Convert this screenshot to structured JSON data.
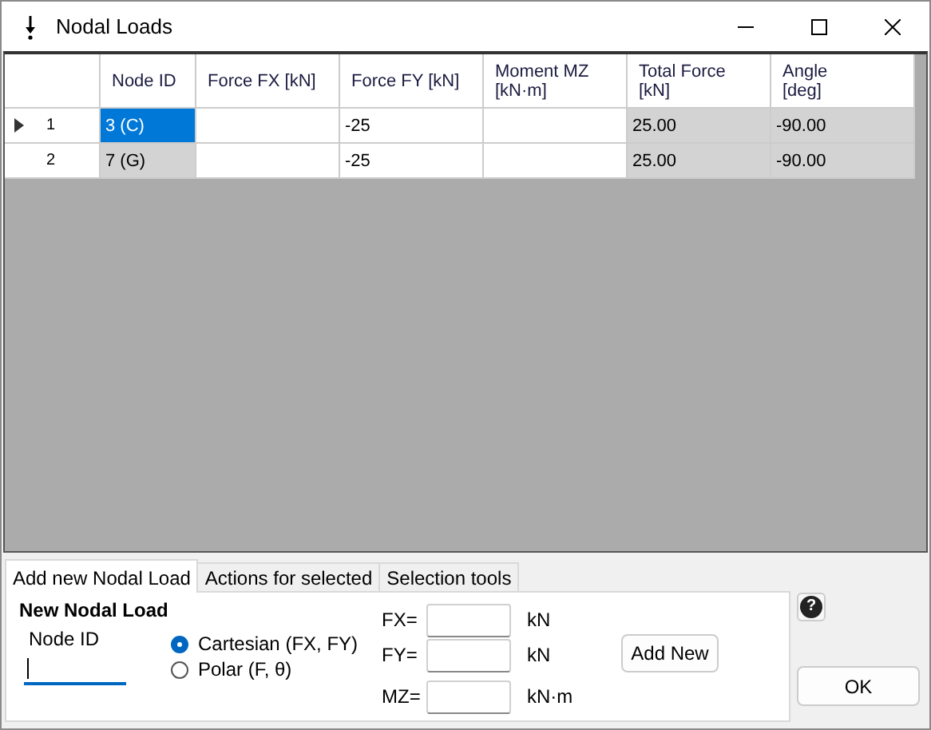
{
  "window": {
    "title": "Nodal Loads"
  },
  "table": {
    "columns": [
      "Node ID",
      "Force FX [kN]",
      "Force FY [kN]",
      "Moment MZ\n[kN·m]",
      "Total Force\n[kN]",
      "Angle\n[deg]"
    ],
    "rows": [
      {
        "number": "1",
        "current": true,
        "cells": [
          {
            "text": "3 (C)",
            "readonly": true,
            "selected": true
          },
          {
            "readonly": false,
            "selected": false
          },
          {
            "text": "-25",
            "readonly": false,
            "selected": false
          },
          {
            "readonly": false,
            "selected": false
          },
          {
            "text": "25.00",
            "readonly": true,
            "selected": false
          },
          {
            "text": "-90.00",
            "readonly": true,
            "selected": false
          }
        ]
      },
      {
        "number": "2",
        "current": false,
        "cells": [
          {
            "text": "7 (G)",
            "readonly": true,
            "selected": false
          },
          {
            "readonly": false,
            "selected": false
          },
          {
            "text": "-25",
            "readonly": false,
            "selected": false
          },
          {
            "readonly": false,
            "selected": false
          },
          {
            "text": "25.00",
            "readonly": true,
            "selected": false
          },
          {
            "text": "-90.00",
            "readonly": true,
            "selected": false
          }
        ]
      }
    ]
  },
  "tabs": [
    {
      "label": "Add new Nodal Load",
      "selected": true
    },
    {
      "label": "Actions for selected",
      "selected": false
    },
    {
      "label": "Selection tools",
      "selected": false
    }
  ],
  "form": {
    "title": "New Nodal Load",
    "node_id_label": "Node ID",
    "node_id_focused": true,
    "modes": [
      {
        "label": "Cartesian (FX, FY)",
        "selected": true
      },
      {
        "label": "Polar (F, θ)",
        "selected": false
      }
    ],
    "forces": [
      {
        "label": "FX=",
        "unit": "kN"
      },
      {
        "label": "FY=",
        "unit": "kN"
      },
      {
        "label": "MZ=",
        "unit": "kN·m"
      }
    ],
    "add_button": "Add New"
  },
  "help_button": "?",
  "ok_button": "OK"
}
